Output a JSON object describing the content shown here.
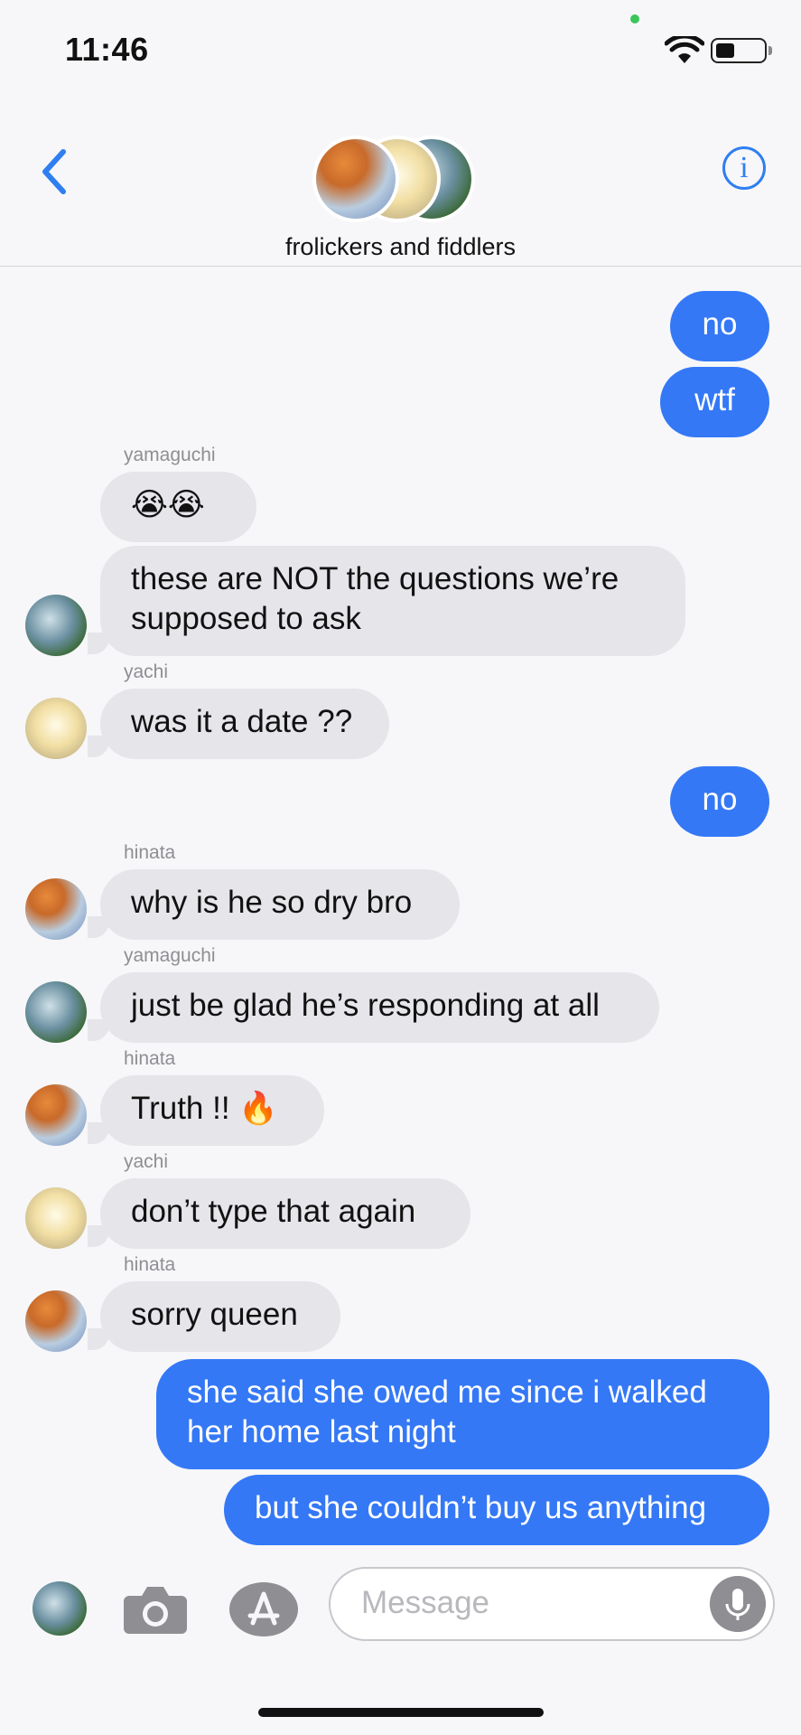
{
  "status": {
    "time": "11:46"
  },
  "header": {
    "title": "frolickers and fiddlers"
  },
  "messages": [
    {
      "text": "no"
    },
    {
      "text": "wtf"
    },
    {
      "sender": "yamaguchi",
      "text": "😭😭"
    },
    {
      "text": "these are NOT the questions we’re"
    },
    {
      "text": "supposed to ask"
    },
    {
      "sender": "yachi",
      "text": "was it a date ??"
    },
    {
      "text": "no"
    },
    {
      "sender": "hinata",
      "text": "why is he so dry bro"
    },
    {
      "sender": "yamaguchi",
      "text": "just be glad he’s responding at all"
    },
    {
      "sender": "hinata",
      "text": "Truth !! 🔥"
    },
    {
      "sender": "yachi",
      "text": "don’t type that again"
    },
    {
      "sender": "hinata",
      "text": "sorry queen"
    },
    {
      "text": "she said she owed me since i walked"
    },
    {
      "text": "her home last night"
    },
    {
      "text": "but she couldn’t buy us anything"
    }
  ],
  "composer": {
    "placeholder": "Message"
  },
  "colors": {
    "accent": "#3478f6",
    "incoming": "#e5e5ea",
    "background": "#f7f7f9"
  },
  "icons": [
    "wifi-icon",
    "battery-icon",
    "back-chevron-icon",
    "info-icon",
    "camera-icon",
    "appstore-icon",
    "microphone-icon"
  ]
}
